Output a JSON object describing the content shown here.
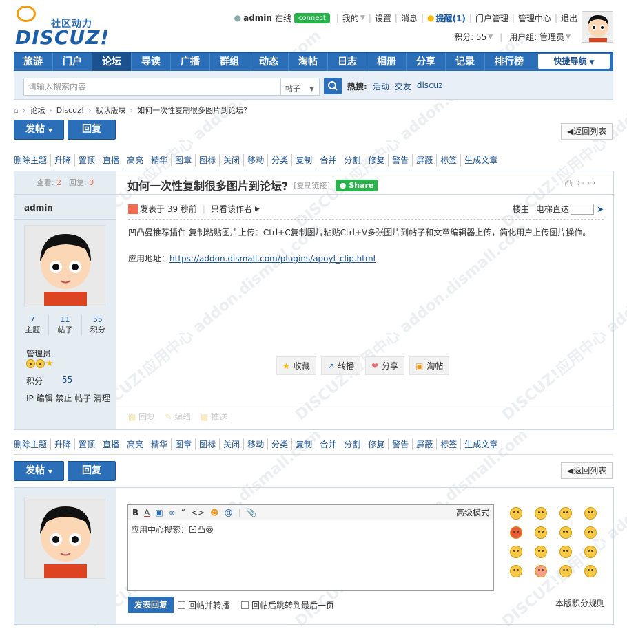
{
  "header": {
    "logo_tagline": "社区动力",
    "logo_brand": "DISCUZ!",
    "username": "admin",
    "online": "在线",
    "connect": "connect",
    "links": [
      "我的",
      "设置",
      "消息"
    ],
    "remind": "提醒(1)",
    "portal_admin": "门户管理",
    "admin_center": "管理中心",
    "logout": "退出",
    "credits": "积分: 55",
    "usergroup": "用户组: 管理员"
  },
  "nav": {
    "items": [
      "旅游",
      "门户",
      "论坛",
      "导读",
      "广播",
      "群组",
      "动态",
      "淘帖",
      "日志",
      "相册",
      "分享",
      "记录",
      "排行榜"
    ],
    "active_index": 2,
    "quick_nav": "快捷导航"
  },
  "search": {
    "placeholder": "请输入搜索内容",
    "type": "帖子",
    "hot_label": "热搜:",
    "hot_words": [
      "活动",
      "交友",
      "discuz"
    ]
  },
  "breadcrumb": [
    "论坛",
    "Discuz!",
    "默认版块",
    "如何一次性复制很多图片到论坛?"
  ],
  "buttons": {
    "post": "发帖",
    "reply": "回复",
    "back_list": "返回列表"
  },
  "mod_actions": [
    "删除主题",
    "升降",
    "置顶",
    "直播",
    "高亮",
    "精华",
    "图章",
    "图标",
    "关闭",
    "移动",
    "分类",
    "复制",
    "合并",
    "分割",
    "修复",
    "警告",
    "屏蔽",
    "标签",
    "生成文章"
  ],
  "thread": {
    "views_label": "查看:",
    "views": "2",
    "replies_label": "回复:",
    "replies": "0",
    "title": "如何一次性复制很多图片到论坛?",
    "copy_link": "[复制链接]",
    "share": "Share"
  },
  "author": {
    "name": "admin",
    "stats": [
      {
        "value": "7",
        "label": "主题"
      },
      {
        "value": "11",
        "label": "帖子"
      },
      {
        "value": "55",
        "label": "积分"
      }
    ],
    "group": "管理员",
    "credits_label": "积分",
    "credits": "55",
    "admin_links": "IP 编辑 禁止 帖子 清理"
  },
  "post": {
    "posted": "发表于 39 秒前",
    "only_author": "只看该作者",
    "floor": "楼主",
    "elevator": "电梯直达",
    "body_line1": "凹凸曼推荐插件 复制粘贴图片上传：Ctrl+C复制图片粘贴Ctrl+V多张图片到帖子和文章编辑器上传，简化用户上传图片操作。",
    "body_label": "应用地址：",
    "body_link": "https://addon.dismall.com/plugins/apoyl_clip.html",
    "actions": [
      "收藏",
      "转播",
      "分享",
      "淘帖"
    ],
    "reply_actions": [
      "回复",
      "编辑",
      "推送"
    ]
  },
  "editor": {
    "advanced": "高级模式",
    "content": "应用中心搜索：凹凸曼",
    "submit": "发表回复",
    "opt1": "回帖并转播",
    "opt2": "回帖后跳转到最后一页",
    "rules": "本版积分规则"
  },
  "colors": {
    "brand_blue": "#2b6fb8",
    "nav_dark": "#1c5190",
    "sidebar_bg": "#e5edf2",
    "accent_red": "#f26c4f"
  }
}
